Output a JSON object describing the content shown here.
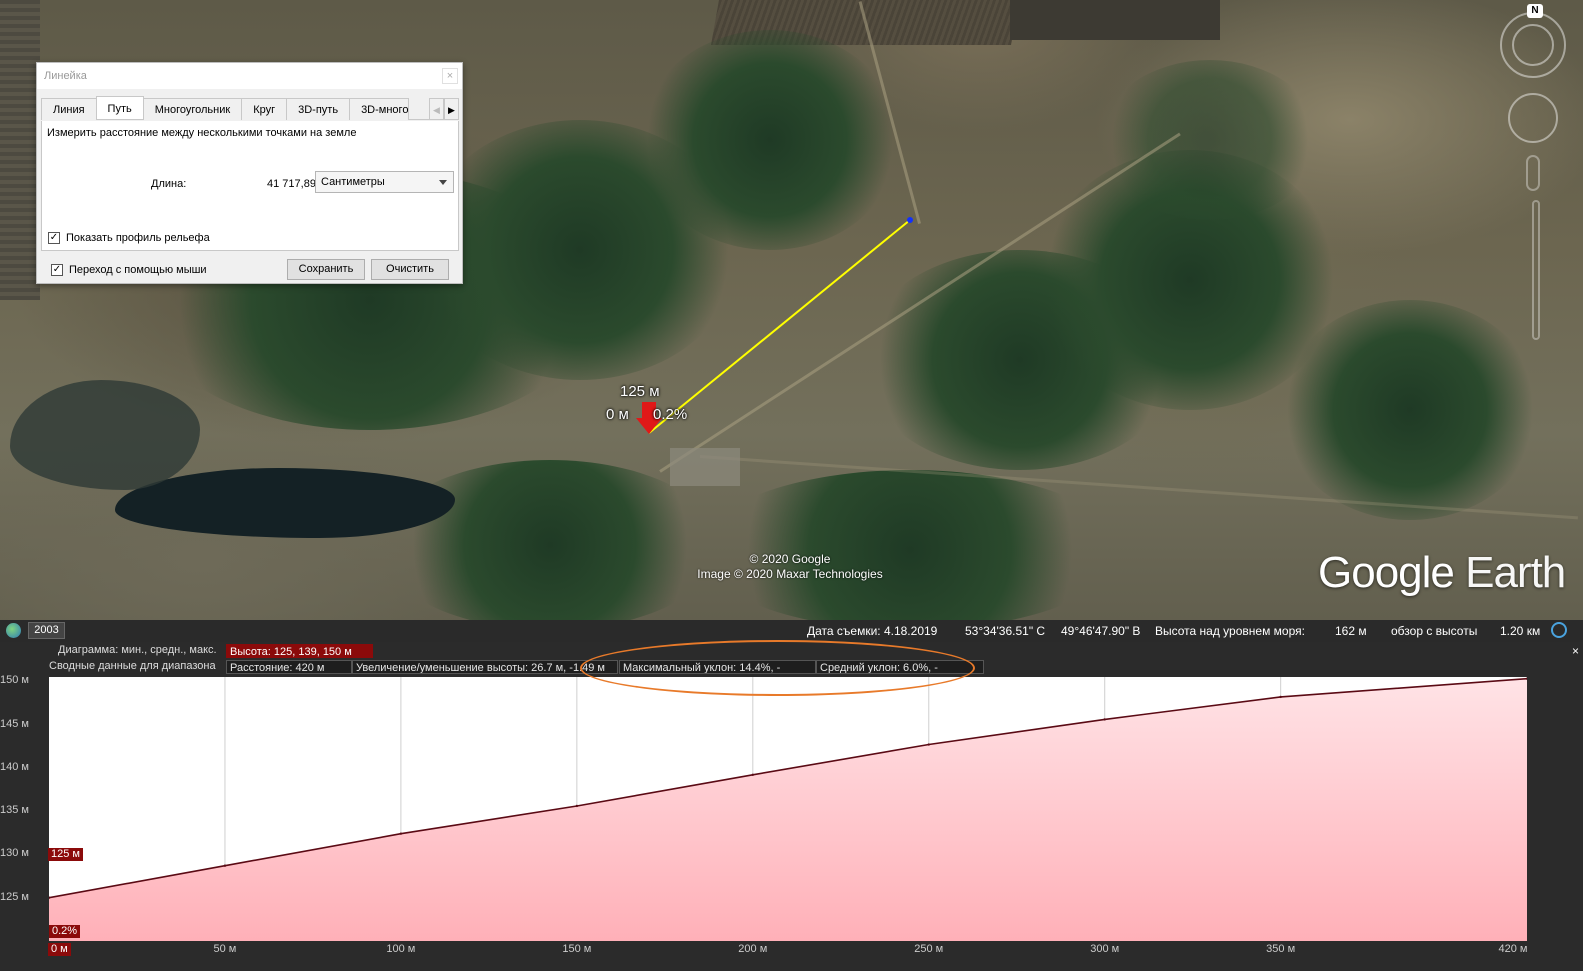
{
  "app": "Google Earth",
  "map": {
    "copyright_line1": "© 2020 Google",
    "copyright_line2": "Image © 2020 Maxar Technologies",
    "logo_word1": "Google",
    "logo_word2": " Earth",
    "north_label": "N",
    "path_color": "#ffff00",
    "marker_elevation": "125 м",
    "marker_distance": "0 м",
    "marker_slope": "0.2%"
  },
  "ruler": {
    "title": "Линейка",
    "close_glyph": "×",
    "tabs": [
      "Линия",
      "Путь",
      "Многоугольник",
      "Круг",
      "3D-путь",
      "3D-многоугольник"
    ],
    "active_tab": "Путь",
    "description": "Измерить расстояние между несколькими точками на земле",
    "length_label": "Длина:",
    "length_value": "41 717,89",
    "units": "Сантиметры",
    "show_profile_label": "Показать профиль рельефа",
    "mouse_nav_label": "Переход с помощью мыши",
    "check_glyph": "✓",
    "save_label": "Сохранить",
    "clear_label": "Очистить"
  },
  "status": {
    "year": "2003",
    "capture_date": "Дата съемки: 4.18.2019",
    "lat": "53°34'36.51\" С",
    "lon": "49°46'47.90\" В",
    "alt_label": "Высота над уровнем моря:",
    "alt_value": "162 м",
    "eye_label": "обзор с высоты",
    "eye_value": "1.20 км"
  },
  "profile": {
    "row1_label": "Диаграмма: мин., средн., макс.",
    "row1_value": "Высота: 125, 139, 150 м",
    "row2_label": "Сводные данные для диапазона",
    "distance": "Расстояние: 420 м",
    "gain_loss": "Увеличение/уменьшение высоты: 26.7 м, -1.49 м",
    "max_slope": "Максимальный уклон: 14.4%, -",
    "avg_slope": "Средний уклон: 6.0%, -",
    "close_glyph": "×",
    "start_tag": "125 м",
    "slope_tag": "0.2%",
    "x_start_tag": "0 м",
    "fill_color": "#ffb0b8",
    "line_color": "#5a0a14",
    "highlight_color": "#e87a2a"
  },
  "chart_data": {
    "type": "area",
    "x": [
      0,
      50,
      100,
      150,
      200,
      250,
      300,
      350,
      420
    ],
    "y": [
      125,
      128.7,
      132.4,
      135.6,
      139.2,
      142.7,
      145.6,
      148.2,
      150.3
    ],
    "x_ticks": [
      "0 м",
      "50 м",
      "100 м",
      "150 м",
      "200 м",
      "250 м",
      "300 м",
      "350 м",
      "420 м"
    ],
    "y_ticks": [
      "125 м",
      "130 м",
      "135 м",
      "140 м",
      "145 м",
      "150 м"
    ],
    "xlim": [
      0,
      420
    ],
    "ylim": [
      120,
      150.5
    ],
    "grid": true
  }
}
